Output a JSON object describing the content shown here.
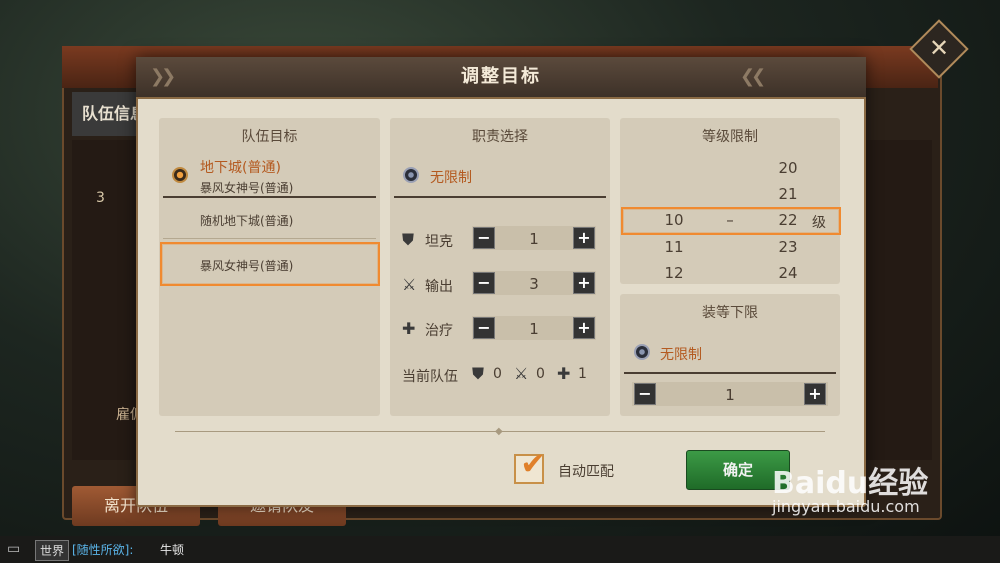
{
  "background": {
    "tab_label": "队伍信息",
    "side_number": "3",
    "side_text": "雇佣",
    "leave_button": "离开队伍",
    "invite_button": "邀请队友",
    "close_icon": "close-icon"
  },
  "dialog": {
    "title": "调整目标",
    "team_goal": {
      "title": "队伍目标",
      "selected_main": "地下城(普通)",
      "selected_sub": "暴风女神号(普通)",
      "options": [
        "随机地下城(普通)",
        "暴风女神号(普通)"
      ]
    },
    "roles": {
      "title": "职责选择",
      "unlimited_label": "无限制",
      "items": [
        {
          "label": "坦克",
          "value": "1",
          "icon": "shield-icon"
        },
        {
          "label": "输出",
          "value": "3",
          "icon": "sword-icon"
        },
        {
          "label": "治疗",
          "value": "1",
          "icon": "cross-icon"
        }
      ],
      "current_label": "当前队伍",
      "current_counts": [
        "0",
        "0",
        "1"
      ]
    },
    "level": {
      "title": "等级限制",
      "right_column": [
        "20",
        "21",
        "22",
        "23",
        "24"
      ],
      "left_column": [
        "",
        "",
        "10",
        "11",
        "12"
      ],
      "dash": "–",
      "unit": "级"
    },
    "gear": {
      "title": "装等下限",
      "unlimited_label": "无限制",
      "value": "1"
    },
    "auto_match_label": "自动匹配",
    "auto_match_checked": true,
    "confirm_label": "确定"
  },
  "chat": {
    "channel": "世界",
    "speaker": "[随性所欲]:",
    "message": "牛顿"
  },
  "watermark": {
    "logo": "Baidu经验",
    "url": "jingyan.baidu.com"
  },
  "colors": {
    "accent_orange": "#f08a30",
    "confirm_green": "#2f8a3a",
    "dialog_bg": "#e3dccb"
  }
}
